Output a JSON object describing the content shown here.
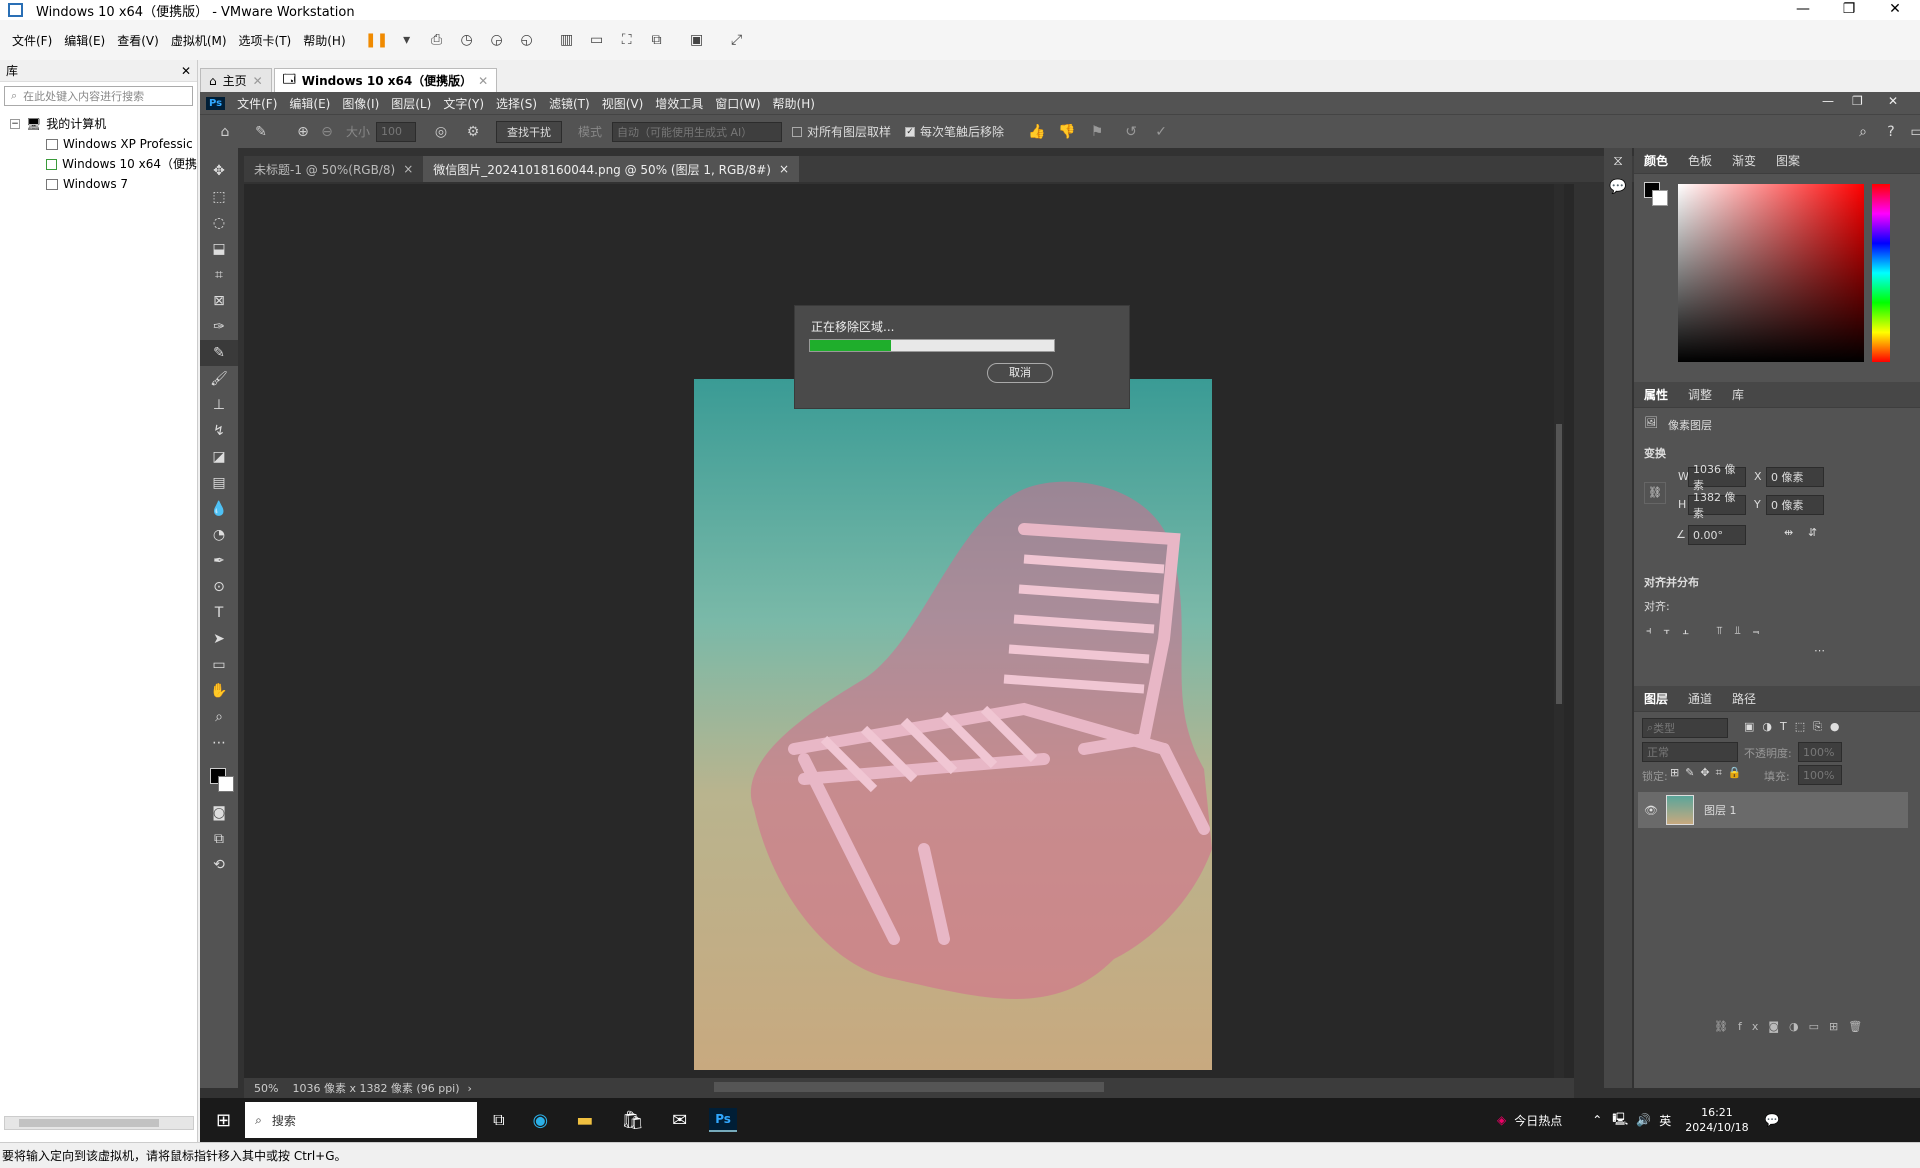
{
  "vmware": {
    "title": "Windows 10 x64（便携版） - VMware Workstation",
    "menu": [
      "文件(F)",
      "编辑(E)",
      "查看(V)",
      "虚拟机(M)",
      "选项卡(T)",
      "帮助(H)"
    ],
    "library_label": "库",
    "search_placeholder": "在此处键入内容进行搜索",
    "tree": {
      "root": "我的计算机",
      "items": [
        "Windows XP Professic",
        "Windows 10 x64（便携",
        "Windows 7"
      ]
    },
    "tabs": [
      {
        "label": "主页",
        "active": false
      },
      {
        "label": "Windows 10 x64（便携版）",
        "active": true
      }
    ],
    "status_text": "要将输入定向到该虚拟机，请将鼠标指针移入其中或按 Ctrl+G。"
  },
  "photoshop": {
    "logo": "Ps",
    "menu": [
      "文件(F)",
      "编辑(E)",
      "图像(I)",
      "图层(L)",
      "文字(Y)",
      "选择(S)",
      "滤镜(T)",
      "视图(V)",
      "增效工具",
      "窗口(W)",
      "帮助(H)"
    ],
    "options": {
      "size_label": "大小",
      "size_value": "100",
      "find_button": "查找干扰",
      "mode_label": "模式",
      "mode_value": "自动（可能使用生成式 AI）",
      "sample_all": "对所有图层取样",
      "remove_after": "每次笔触后移除"
    },
    "doc_tabs": [
      {
        "label": "未标题-1 @ 50%(RGB/8)",
        "active": false
      },
      {
        "label": "微信图片_20241018160044.png @ 50% (图层 1, RGB/8#)",
        "active": true
      }
    ],
    "status": {
      "zoom": "50%",
      "dims": "1036 像素 x 1382 像素 (96 ppi)"
    },
    "dialog": {
      "title": "正在移除区域...",
      "progress": 0.33,
      "cancel": "取消"
    },
    "color_tabs": [
      "颜色",
      "色板",
      "渐变",
      "图案"
    ],
    "props_tabs": [
      "属性",
      "调整",
      "库"
    ],
    "props": {
      "layer_type": "像素图层",
      "transform_title": "变换",
      "w_label": "W",
      "w_value": "1036 像素",
      "h_label": "H",
      "h_value": "1382 像素",
      "x_label": "X",
      "x_value": "0 像素",
      "y_label": "Y",
      "y_value": "0 像素",
      "angle": "0.00°",
      "align_title": "对齐并分布",
      "align_label": "对齐:"
    },
    "layers_tabs": [
      "图层",
      "通道",
      "路径"
    ],
    "layers": {
      "filter_placeholder": "类型",
      "blend": "正常",
      "opacity_label": "不透明度:",
      "opacity_value": "100%",
      "lock_label": "锁定:",
      "fill_label": "填充:",
      "fill_value": "100%",
      "items": [
        {
          "name": "图层 1"
        }
      ]
    }
  },
  "taskbar": {
    "search": "搜索",
    "news": "今日热点",
    "ime": "英",
    "time": "16:21",
    "date": "2024/10/18"
  },
  "colors": {
    "ps_bg": "#535353",
    "canvas_bg": "#282828",
    "progress_green": "#1fae2c",
    "selection_pink": "#d36a8e"
  }
}
